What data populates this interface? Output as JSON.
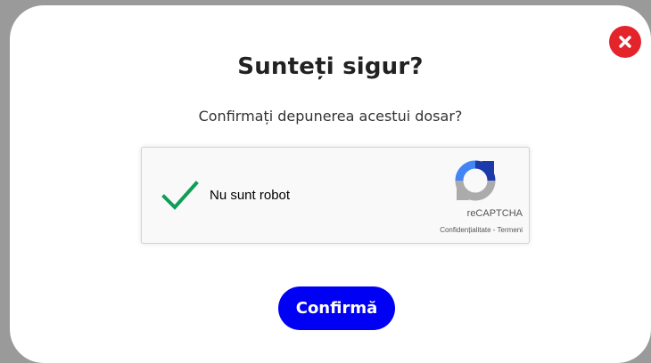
{
  "modal": {
    "title": "Sunteți sigur?",
    "subtitle": "Confirmați depunerea acestui dosar?",
    "confirm_label": "Confirmă",
    "close_icon": "close-icon"
  },
  "captcha": {
    "label": "Nu sunt robot",
    "checked": true,
    "brand": "reCAPTCHA",
    "privacy_label": "Confidențialitate",
    "separator": "-",
    "terms_label": "Termeni"
  },
  "colors": {
    "confirm_button": "#0000f5",
    "close_button": "#e3242b",
    "checkmark": "#0f9d58",
    "overlay": "#9a9a9a"
  }
}
